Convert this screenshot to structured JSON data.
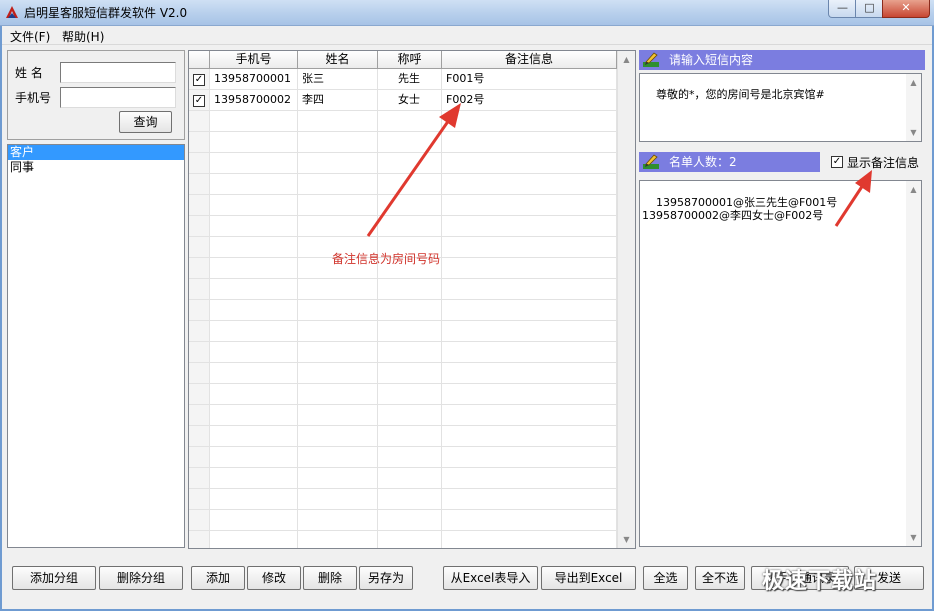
{
  "window": {
    "title": "启明星客服短信群发软件 V2.0",
    "min_glyph": "—",
    "max_glyph": "□",
    "close_glyph": "✕"
  },
  "menu": [
    "文件(F)",
    "帮助(H)"
  ],
  "query": {
    "name_label": "姓 名",
    "phone_label": "手机号",
    "name_value": "",
    "phone_value": "",
    "search_button": "查询"
  },
  "groups": [
    {
      "label": "客户",
      "selected": true
    },
    {
      "label": "同事",
      "selected": false
    }
  ],
  "grid": {
    "columns": [
      "手机号",
      "姓名",
      "称呼",
      "备注信息"
    ],
    "rows": [
      {
        "checked": true,
        "phone": "13958700001",
        "name": "张三",
        "title": "先生",
        "note": "F001号"
      },
      {
        "checked": true,
        "phone": "13958700002",
        "name": "李四",
        "title": "女士",
        "note": "F002号"
      }
    ],
    "annotation": "备注信息为房间号码"
  },
  "sms": {
    "header": "请输入短信内容",
    "content": "尊敬的*，您的房间号是北京宾馆#"
  },
  "recipients": {
    "header": "名单人数：2",
    "show_notes_label": "显示备注信息",
    "show_notes_checked": true,
    "list": "13958700001@张三先生@F001号\n13958700002@李四女士@F002号"
  },
  "buttons": {
    "add_group": "添加分组",
    "delete_group": "删除分组",
    "add": "添加",
    "edit": "修改",
    "delete": "删除",
    "save_as": "另存为",
    "import_excel": "从Excel表导入",
    "export_excel": "导出到Excel",
    "select_all": "全选",
    "select_none": "全不选",
    "from_phone": "从手机通讯录",
    "last": "发送"
  },
  "watermark": "极速下载站",
  "colors": {
    "panel_header": "#7b7de0",
    "selection": "#3399ff",
    "annotation": "#d0332b"
  }
}
